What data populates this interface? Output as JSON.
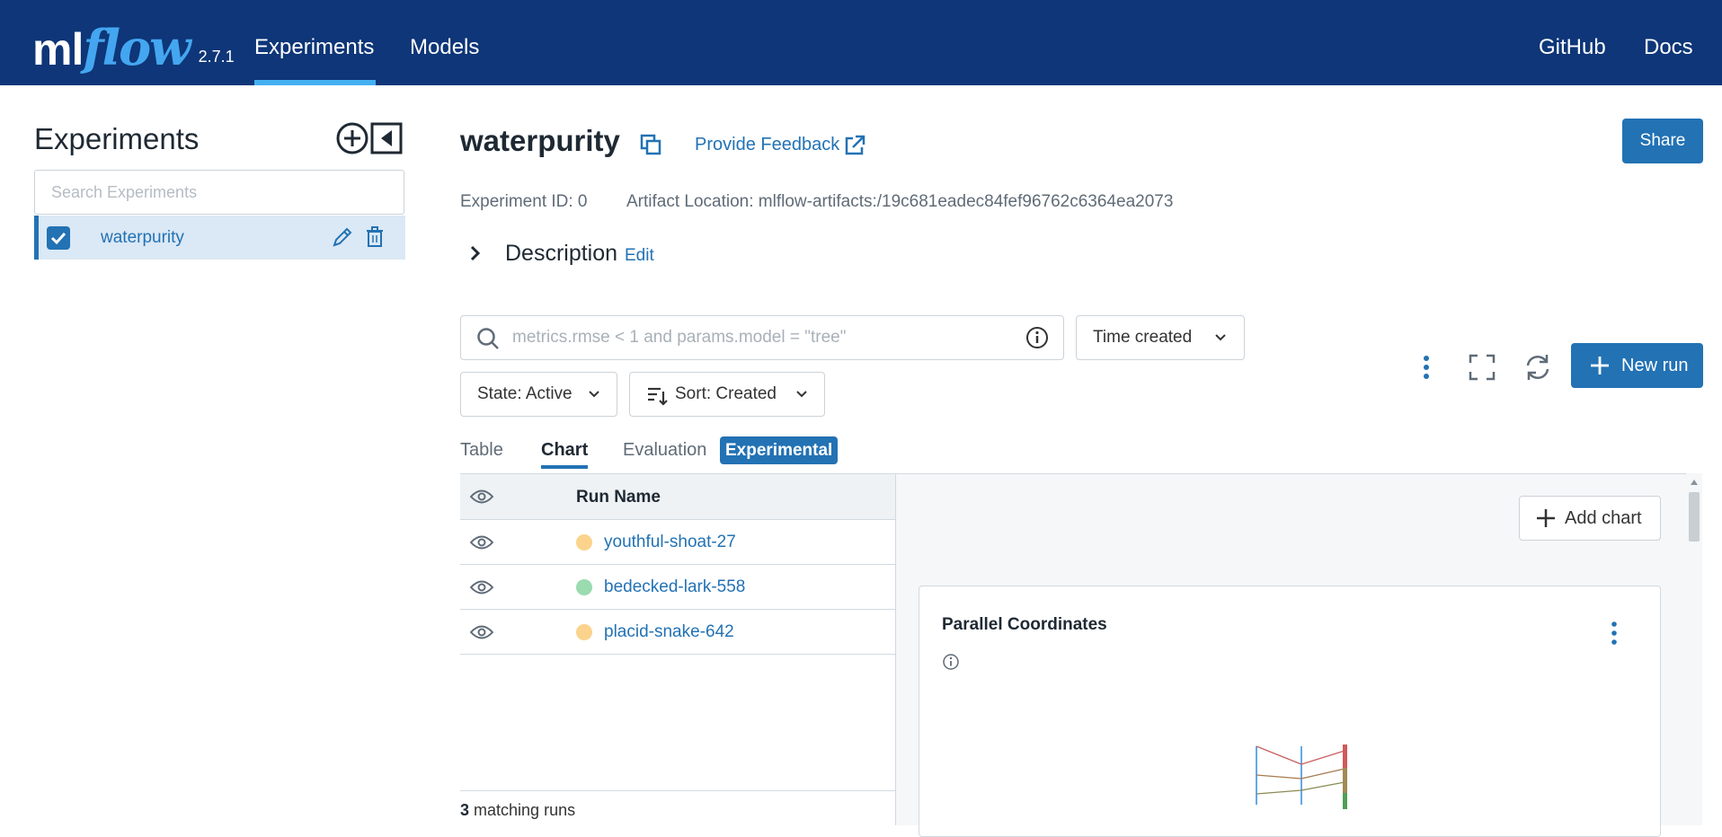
{
  "header": {
    "logo_ml": "ml",
    "logo_flow": "flow",
    "version": "2.7.1",
    "nav": [
      {
        "label": "Experiments",
        "active": true
      },
      {
        "label": "Models",
        "active": false
      }
    ],
    "right_links": [
      "GitHub",
      "Docs"
    ]
  },
  "sidebar": {
    "title": "Experiments",
    "search_placeholder": "Search Experiments",
    "experiments": [
      {
        "name": "waterpurity",
        "checked": true
      }
    ]
  },
  "experiment": {
    "title": "waterpurity",
    "feedback_label": "Provide Feedback",
    "share_label": "Share",
    "id_text": "Experiment ID: 0",
    "artifact_text": "Artifact Location: mlflow-artifacts:/19c681eadec84fef96762c6364ea2073",
    "description_label": "Description",
    "description_edit": "Edit"
  },
  "toolbar": {
    "query_placeholder": "metrics.rmse < 1 and params.model = \"tree\"",
    "time_dropdown": "Time created",
    "state_dropdown": "State: Active",
    "sort_dropdown": "Sort: Created",
    "new_run_label": "New run"
  },
  "tabs": {
    "table": "Table",
    "chart": "Chart",
    "evaluation": "Evaluation",
    "experimental_tag": "Experimental",
    "active": "Chart"
  },
  "runs": {
    "column_header": "Run Name",
    "rows": [
      {
        "name": "youthful-shoat-27",
        "color": "#fbd38d"
      },
      {
        "name": "bedecked-lark-558",
        "color": "#9adbb0"
      },
      {
        "name": "placid-snake-642",
        "color": "#fbd38d"
      }
    ],
    "matching_count": "3",
    "matching_label": "matching runs"
  },
  "charts": {
    "add_chart_label": "Add chart",
    "cards": [
      {
        "title": "Parallel Coordinates"
      }
    ]
  },
  "colors": {
    "header_bg": "#0e3678",
    "accent": "#2272b4",
    "nav_underline": "#44b0f0"
  }
}
